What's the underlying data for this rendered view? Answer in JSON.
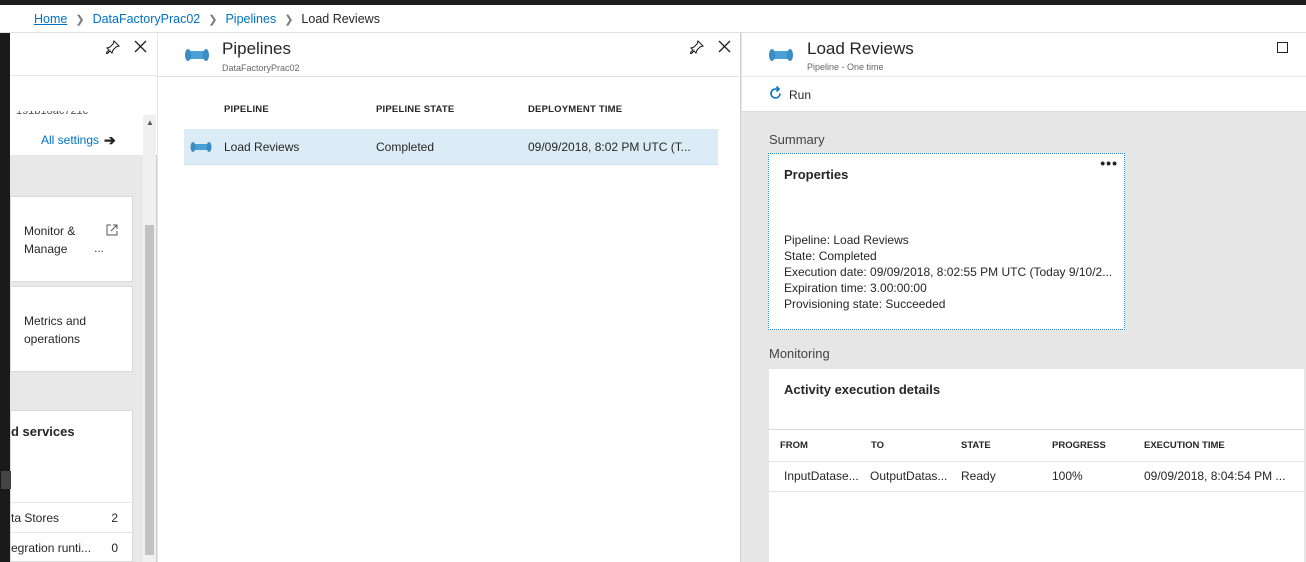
{
  "breadcrumb": {
    "home": "Home",
    "items": [
      "DataFactoryPrac02",
      "Pipelines",
      "Load Reviews"
    ]
  },
  "left_blade": {
    "clipped_id": "191b18ac721c",
    "all_settings": "All settings",
    "cards": [
      {
        "label_line1": "Monitor &",
        "label_line2": "Manage",
        "more": "..."
      },
      {
        "label_line1": "Metrics and",
        "label_line2": "operations"
      }
    ],
    "services_heading": "d services",
    "service_rows": [
      {
        "label": "ta Stores",
        "count": "2"
      },
      {
        "label": "egration runti...",
        "count": "0"
      }
    ]
  },
  "pipelines_blade": {
    "title": "Pipelines",
    "subtitle": "DataFactoryPrac02",
    "columns": [
      "PIPELINE",
      "PIPELINE STATE",
      "DEPLOYMENT TIME"
    ],
    "rows": [
      {
        "name": "Load Reviews",
        "state": "Completed",
        "deployment_time": "09/09/2018, 8:02 PM UTC (T..."
      }
    ]
  },
  "load_reviews_blade": {
    "title": "Load Reviews",
    "subtitle": "Pipeline - One time",
    "run_label": "Run",
    "summary_label": "Summary",
    "properties": {
      "title": "Properties",
      "more": "•••",
      "lines": [
        "Pipeline: Load Reviews",
        "State: Completed",
        "Execution date: 09/09/2018, 8:02:55 PM UTC (Today 9/10/2...",
        "Expiration time: 3.00:00:00",
        "Provisioning state: Succeeded"
      ]
    },
    "monitoring_label": "Monitoring",
    "activity": {
      "title": "Activity execution details",
      "columns": [
        "FROM",
        "TO",
        "STATE",
        "PROGRESS",
        "EXECUTION TIME"
      ],
      "rows": [
        {
          "from": "InputDatase...",
          "to": "OutputDatas...",
          "state": "Ready",
          "progress": "100%",
          "execution_time": "09/09/2018, 8:04:54 PM ..."
        }
      ]
    }
  },
  "colors": {
    "link": "#0072c6",
    "selected_row": "#dcecf7",
    "focus_border": "#2f8fd0",
    "pipeline_icon": "#4a9fd4"
  },
  "icons": {
    "pipeline": "pipeline-icon",
    "pin": "pin-icon",
    "close": "close-icon",
    "maximize": "maximize-icon",
    "run": "refresh-icon",
    "external": "external-link-icon"
  }
}
